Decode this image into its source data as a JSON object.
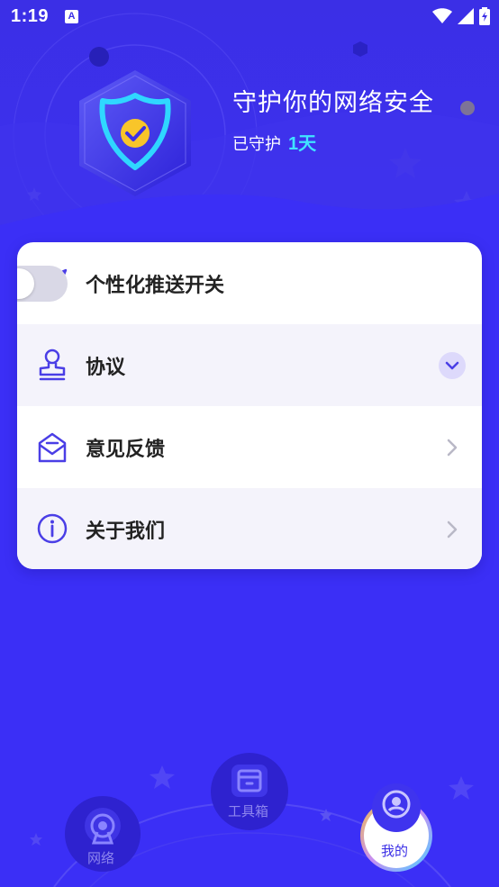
{
  "status": {
    "time": "1:19"
  },
  "header": {
    "title": "守护你的网络安全",
    "sub_prefix": "已守护",
    "days": "1天"
  },
  "menu": {
    "push": {
      "label": "个性化推送开关"
    },
    "agreement": {
      "label": "协议"
    },
    "feedback": {
      "label": "意见反馈"
    },
    "about": {
      "label": "关于我们"
    }
  },
  "nav": {
    "items": [
      {
        "label": "网络",
        "icon": "radar-icon"
      },
      {
        "label": "工具箱",
        "icon": "toolbox-icon"
      },
      {
        "label": "我的",
        "icon": "profile-icon"
      }
    ]
  }
}
